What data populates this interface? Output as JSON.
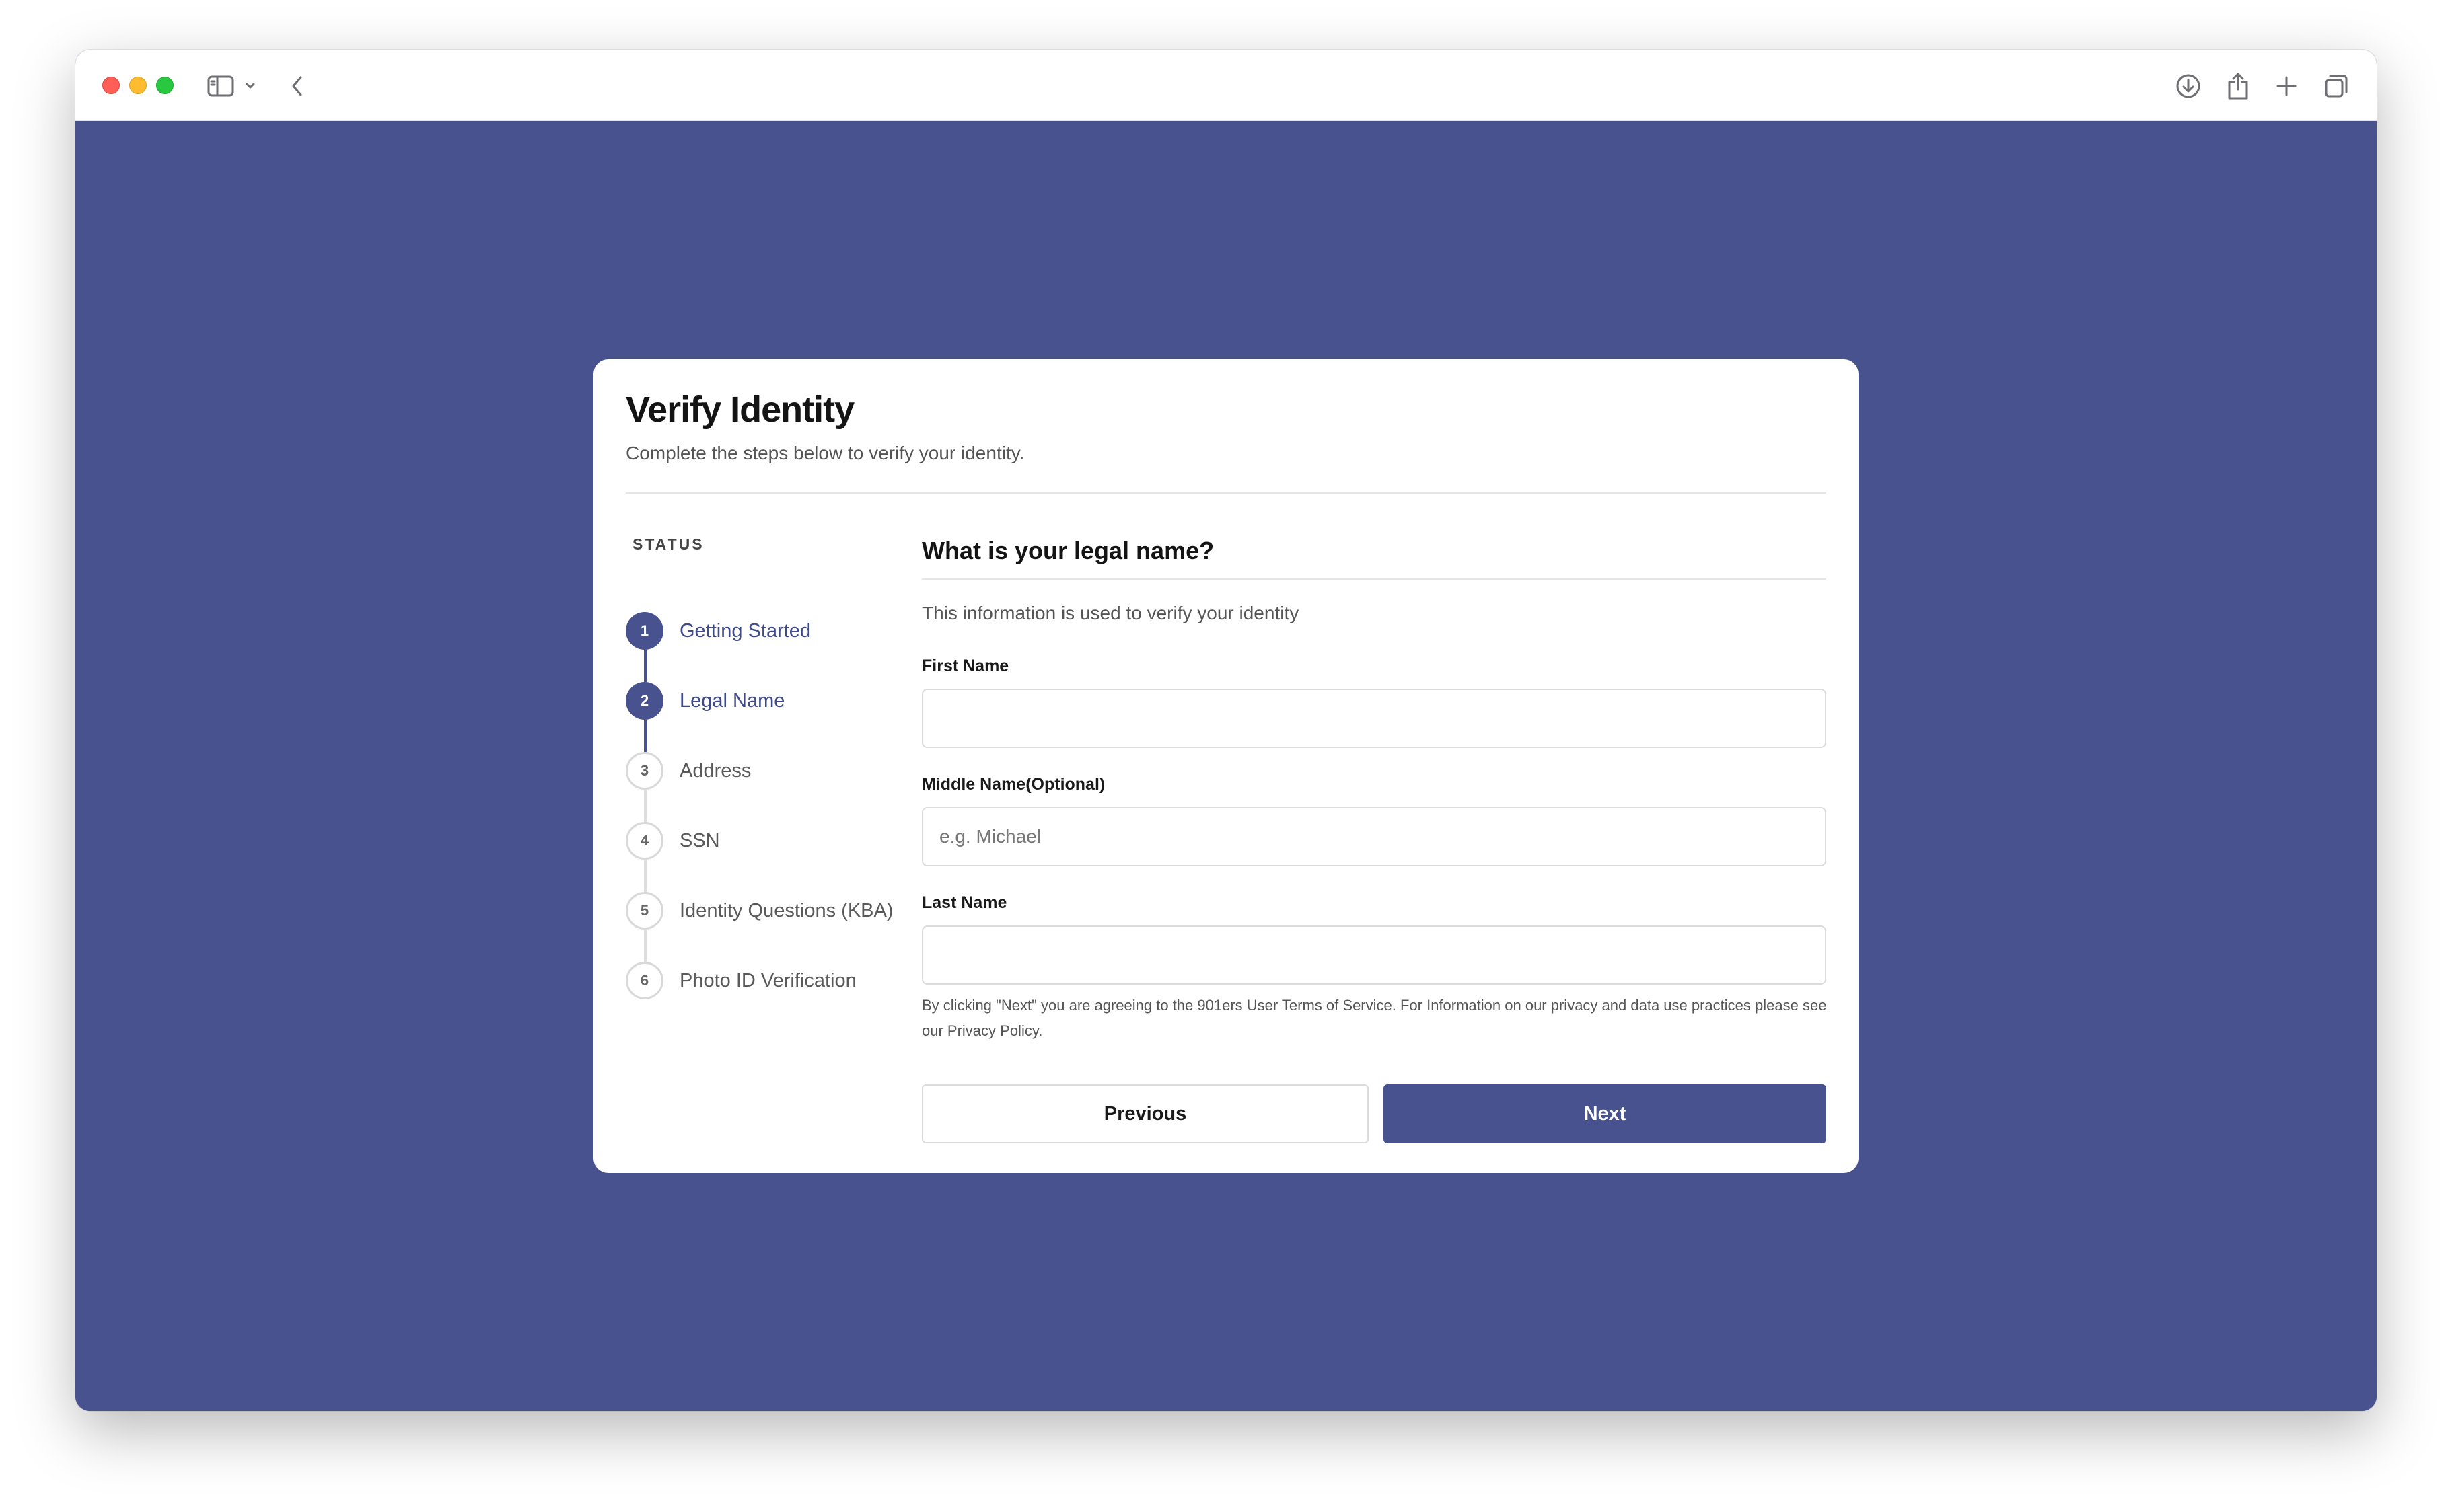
{
  "card": {
    "title": "Verify Identity",
    "subtitle": "Complete the steps below to verify your identity."
  },
  "status": {
    "label": "STATUS",
    "steps": [
      {
        "number": "1",
        "label": "Getting Started",
        "state": "active"
      },
      {
        "number": "2",
        "label": "Legal Name",
        "state": "active"
      },
      {
        "number": "3",
        "label": "Address",
        "state": "inactive"
      },
      {
        "number": "4",
        "label": "SSN",
        "state": "inactive"
      },
      {
        "number": "5",
        "label": "Identity Questions (KBA)",
        "state": "inactive"
      },
      {
        "number": "6",
        "label": "Photo ID Verification",
        "state": "inactive"
      }
    ]
  },
  "form": {
    "question": "What is your legal name?",
    "info": "This information is used to verify your identity",
    "first_name": {
      "label": "First Name",
      "value": "",
      "placeholder": ""
    },
    "middle_name": {
      "label": "Middle Name(Optional)",
      "value": "",
      "placeholder": "e.g. Michael"
    },
    "last_name": {
      "label": "Last Name",
      "value": "",
      "placeholder": ""
    },
    "terms": "By clicking \"Next\" you are agreeing to the 901ers User Terms of Service. For Information on our privacy and data use practices please see our Privacy Policy.",
    "previous_label": "Previous",
    "next_label": "Next"
  },
  "colors": {
    "accent": "#48528f",
    "background": "#48528f",
    "card": "#ffffff"
  },
  "icons": [
    "sidebar-icon",
    "chevron-down-icon",
    "back-chevron-icon",
    "download-icon",
    "share-icon",
    "plus-icon",
    "tabs-icon"
  ]
}
